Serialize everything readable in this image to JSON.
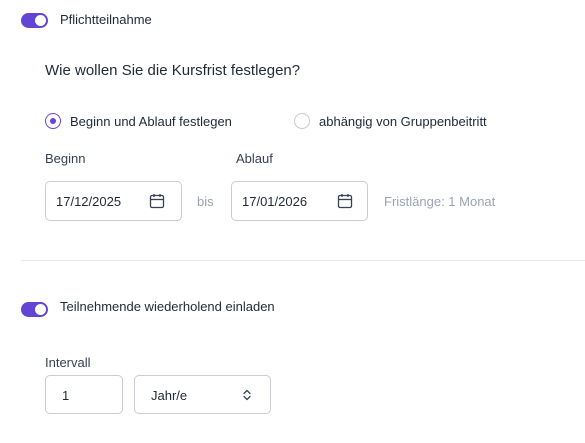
{
  "mandatory": {
    "toggle_on": true,
    "label": "Pflichtteilnahme"
  },
  "deadline": {
    "question": "Wie wollen Sie die Kursfrist festlegen?",
    "options": [
      {
        "label": "Beginn und Ablauf festlegen",
        "selected": true
      },
      {
        "label": "abhängig von Gruppenbeitritt",
        "selected": false
      }
    ],
    "start_label": "Beginn",
    "start_value": "17/12/2025",
    "separator": "bis",
    "end_label": "Ablauf",
    "end_value": "17/01/2026",
    "duration_text": "Fristlänge: 1 Monat"
  },
  "recurring": {
    "toggle_on": true,
    "label": "Teilnehmende wiederholend einladen",
    "interval_label": "Intervall",
    "interval_value": "1",
    "unit_value": "Jahr/e"
  },
  "icons": {
    "calendar": "calendar-icon",
    "chevron": "chevron-up-down-icon"
  },
  "colors": {
    "accent": "#6345d6",
    "border": "#c9ccd3",
    "muted_text": "#9ca3af"
  }
}
